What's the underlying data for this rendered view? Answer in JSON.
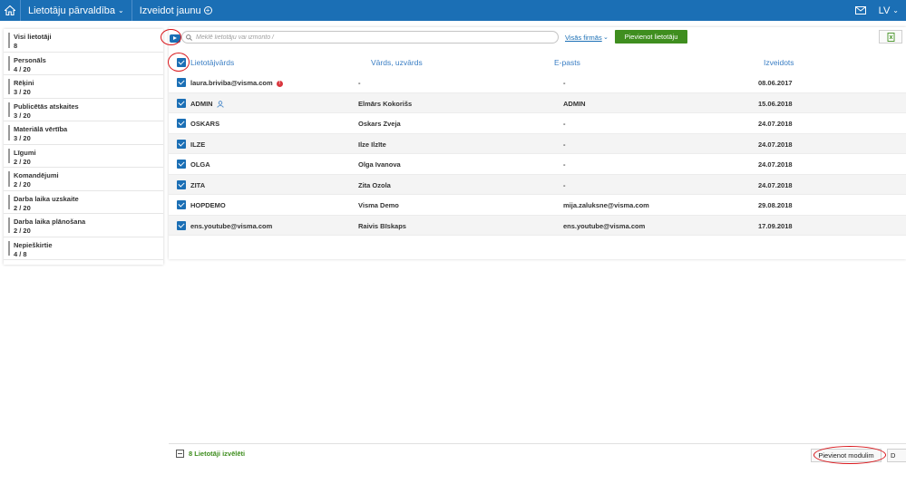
{
  "topbar": {
    "title": "Lietotāju pārvaldība",
    "create_new": "Izveidot jaunu",
    "lang": "LV"
  },
  "sidebar": {
    "items": [
      {
        "label": "Visi lietotāji",
        "count": "8"
      },
      {
        "label": "Personāls",
        "count": "4 / 20"
      },
      {
        "label": "Rēķini",
        "count": "3 / 20"
      },
      {
        "label": "Publicētās atskaites",
        "count": "3 / 20"
      },
      {
        "label": "Materiālā vērtība",
        "count": "3 / 20"
      },
      {
        "label": "Līgumi",
        "count": "2 / 20"
      },
      {
        "label": "Komandējumi",
        "count": "2 / 20"
      },
      {
        "label": "Darba laika uzskaite",
        "count": "2 / 20"
      },
      {
        "label": "Darba laika plānošana",
        "count": "2 / 20"
      },
      {
        "label": "Nepieškirtie",
        "count": "4 / 8"
      }
    ]
  },
  "toolbar": {
    "search_placeholder": "Meklē lietotāju vai izmonto /",
    "filter_label": "Visās firmās",
    "add_user_label": "Pievienot lietotāju"
  },
  "table": {
    "headers": {
      "username": "Lietotājvārds",
      "name": "Vārds, uzvārds",
      "email": "E-pasts",
      "created": "Izveidots"
    },
    "rows": [
      {
        "username": "laura.briviba@visma.com",
        "name": "-",
        "email": "-",
        "created": "08.06.2017"
      },
      {
        "username": "ADMIN",
        "name": "Elmārs Kokorišs",
        "email": "ADMIN",
        "created": "15.06.2018"
      },
      {
        "username": "OSKARS",
        "name": "Oskars Zveja",
        "email": "-",
        "created": "24.07.2018"
      },
      {
        "username": "ILZE",
        "name": "Ilze Ilzīte",
        "email": "-",
        "created": "24.07.2018"
      },
      {
        "username": "OLGA",
        "name": "Olga Ivanova",
        "email": "-",
        "created": "24.07.2018"
      },
      {
        "username": "ZITA",
        "name": "Zita Ozola",
        "email": "-",
        "created": "24.07.2018"
      },
      {
        "username": "HOPDEMO",
        "name": "Visma Demo",
        "email": "mija.zaluksne@visma.com",
        "created": "29.08.2018"
      },
      {
        "username": "ens.youtube@visma.com",
        "name": "Raivis Bīskaps",
        "email": "ens.youtube@visma.com",
        "created": "17.09.2018"
      }
    ]
  },
  "bottombar": {
    "selected_text": "8 Lietotāji izvēlēti",
    "add_module_label": "Pievienot modulim",
    "d_label": "D"
  },
  "colors": {
    "brand": "#1b6fb5",
    "accent_green": "#3f8e1f",
    "annotation_red": "#d9161b"
  }
}
